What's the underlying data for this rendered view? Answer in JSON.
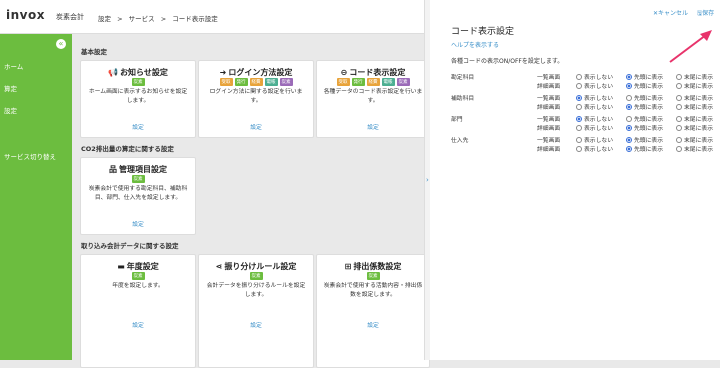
{
  "header": {
    "logo": "invox",
    "logo_sub": "炭素会計",
    "breadcrumb": [
      "設定",
      ">",
      "サービス",
      ">",
      "コード表示設定"
    ]
  },
  "sidebar": {
    "items": [
      {
        "label": "ホーム"
      },
      {
        "label": "算定"
      },
      {
        "label": "設定"
      },
      {
        "label": "サービス切り替え"
      }
    ]
  },
  "sections": [
    {
      "title": "基本設定",
      "cards": [
        {
          "title": "お知らせ設定",
          "icon": "megaphone-icon",
          "badges": [
            {
              "label": "炭素",
              "color": "#6cbd3f"
            }
          ],
          "desc": "ホーム画面に表示するお知らせを設定します。",
          "link": "設定"
        },
        {
          "title": "ログイン方法設定",
          "icon": "login-icon",
          "badges": [
            {
              "label": "受取",
              "color": "#e8a33a"
            },
            {
              "label": "発行",
              "color": "#6cbd3f"
            },
            {
              "label": "経費",
              "color": "#e8a33a"
            },
            {
              "label": "電帳",
              "color": "#4caf92"
            },
            {
              "label": "炭素",
              "color": "#9b6bb8"
            }
          ],
          "desc": "ログイン方法に関する設定を行います。",
          "link": "設定"
        },
        {
          "title": "コード表示設定",
          "icon": "code-icon",
          "badges": [
            {
              "label": "受取",
              "color": "#e8a33a"
            },
            {
              "label": "発行",
              "color": "#6cbd3f"
            },
            {
              "label": "経費",
              "color": "#e8a33a"
            },
            {
              "label": "電帳",
              "color": "#4caf92"
            },
            {
              "label": "炭素",
              "color": "#9b6bb8"
            }
          ],
          "desc": "各種データのコード表示設定を行います。",
          "link": "設定"
        }
      ]
    },
    {
      "title": "CO2排出量の算定に関する設定",
      "cards": [
        {
          "title": "管理項目設定",
          "icon": "org-icon",
          "badges": [
            {
              "label": "炭素",
              "color": "#6cbd3f"
            }
          ],
          "desc": "炭素会計で使用する勘定科目、補助科目、部門、仕入先を設定します。",
          "link": "設定"
        }
      ]
    },
    {
      "title": "取り込み会計データに関する設定",
      "cards": [
        {
          "title": "年度設定",
          "icon": "calendar-icon",
          "badges": [
            {
              "label": "炭素",
              "color": "#6cbd3f"
            }
          ],
          "desc": "年度を設定します。",
          "link": "設定"
        },
        {
          "title": "振り分けルール設定",
          "icon": "branch-icon",
          "badges": [
            {
              "label": "炭素",
              "color": "#6cbd3f"
            }
          ],
          "desc": "会計データを振り分けるルールを設定します。",
          "link": "設定"
        },
        {
          "title": "排出係数設定",
          "icon": "grid-icon",
          "badges": [
            {
              "label": "炭素",
              "color": "#6cbd3f"
            }
          ],
          "desc": "炭素会計で使用する活動内容・排出係数を設定します。",
          "link": "設定"
        }
      ]
    }
  ],
  "panel": {
    "cancel_label": "キャンセル",
    "save_label": "保存",
    "title": "コード表示設定",
    "help_link": "ヘルプを表示する",
    "description": "各種コードの表示ON/OFFを設定します。",
    "options": [
      "表示しない",
      "先頭に表示",
      "末尾に表示"
    ],
    "rows": [
      {
        "label": "勘定科目",
        "subs": [
          {
            "label": "一覧画面",
            "selected": 1
          },
          {
            "label": "詳細画面",
            "selected": 1
          }
        ]
      },
      {
        "label": "補助科目",
        "subs": [
          {
            "label": "一覧画面",
            "selected": 0
          },
          {
            "label": "詳細画面",
            "selected": 1
          }
        ]
      },
      {
        "label": "部門",
        "subs": [
          {
            "label": "一覧画面",
            "selected": 0
          },
          {
            "label": "詳細画面",
            "selected": 1
          }
        ]
      },
      {
        "label": "仕入先",
        "subs": [
          {
            "label": "一覧画面",
            "selected": 1
          },
          {
            "label": "詳細画面",
            "selected": 1
          }
        ]
      }
    ]
  },
  "colors": {
    "accent": "#6cbd3f",
    "link": "#3a8fc8",
    "arrow": "#e8336b"
  }
}
